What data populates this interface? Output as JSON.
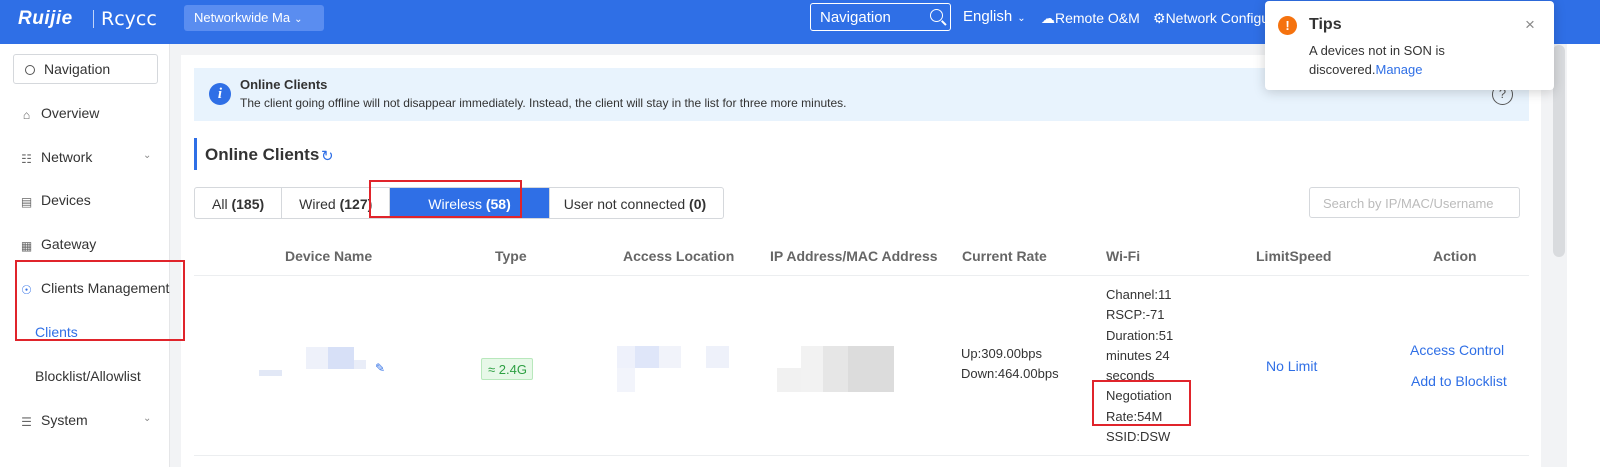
{
  "topbar": {
    "logo": "Ruijie",
    "logo2": "Rcycc",
    "network_select": "Networkwide Ma",
    "search_value": "Navigation",
    "language": "English",
    "remote_om": "Remote O&M",
    "network_config": "Network Configu"
  },
  "sidebar": {
    "search_value": "Navigation",
    "items": [
      {
        "label": "Overview",
        "icon": "home-icon"
      },
      {
        "label": "Network",
        "icon": "network-icon"
      },
      {
        "label": "Devices",
        "icon": "devices-icon"
      },
      {
        "label": "Gateway",
        "icon": "gateway-icon"
      },
      {
        "label": "Clients Management",
        "icon": "user-circle-icon"
      },
      {
        "label": "System",
        "icon": "sliders-icon"
      }
    ],
    "sub_items": [
      "Clients",
      "Blocklist/Allowlist"
    ],
    "active_sub": "Clients"
  },
  "banner": {
    "title": "Online Clients",
    "text": "The client going offline will not disappear immediately. Instead, the client will stay in the list for three more minutes."
  },
  "section": {
    "title": "Online Clients"
  },
  "tabs": [
    {
      "label": "All",
      "count": "(185)"
    },
    {
      "label": "Wired",
      "count": "(127)"
    },
    {
      "label": "Wireless",
      "count": "(58)"
    },
    {
      "label": "User not connected",
      "count": "(0)"
    }
  ],
  "active_tab": "Wireless",
  "search": {
    "placeholder": "Search by IP/MAC/Username"
  },
  "table": {
    "headers": [
      "Device Name",
      "Type",
      "Access Location",
      "IP Address/MAC Address",
      "Current Rate",
      "Wi-Fi",
      "LimitSpeed",
      "Action"
    ],
    "rows": [
      {
        "type_badge": "2.4G",
        "rate_up": "Up:309.00bps",
        "rate_down": "Down:464.00bps",
        "wifi": [
          "Channel:11",
          "RSCP:-71",
          "Duration:51",
          "minutes 24",
          "seconds",
          "Negotiation",
          "Rate:54M",
          "SSID:DSW"
        ],
        "limit_speed": "No Limit",
        "actions": [
          "Access Control",
          "Add to Blocklist"
        ]
      }
    ]
  },
  "toast": {
    "title": "Tips",
    "message": "A devices not in SON is discovered.",
    "link": "Manage"
  },
  "colors": {
    "brand": "#2f6fe6",
    "warning": "#f5720e",
    "success": "#2ea043",
    "annotation": "#e0242b"
  }
}
